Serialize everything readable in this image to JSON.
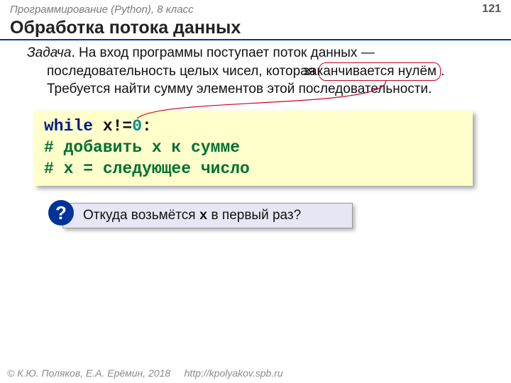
{
  "header": {
    "course": "Программирование (Python), 8 класс",
    "page_number": "121"
  },
  "title": "Обработка потока данных",
  "task": {
    "label": "Задача",
    "text_before": ". На вход программы поступает поток данных — последовательность целых чисел, которая ",
    "highlight": "заканчивается нулём",
    "text_after": ". Требуется найти сумму элементов этой последовательности."
  },
  "code": {
    "kw_while": "while",
    "cond_var": " x!=",
    "cond_zero": "0",
    "cond_colon": ":",
    "comment1": "  # добавить x к сумме",
    "comment2": "  # x = следующее число"
  },
  "question": {
    "mark": "?",
    "before": "Откуда возьмётся ",
    "var": "x",
    "after": " в первый раз?"
  },
  "footer": {
    "copyright": "© К.Ю. Поляков, Е.А. Ерёмин, 2018",
    "url": "http://kpolyakov.spb.ru"
  }
}
